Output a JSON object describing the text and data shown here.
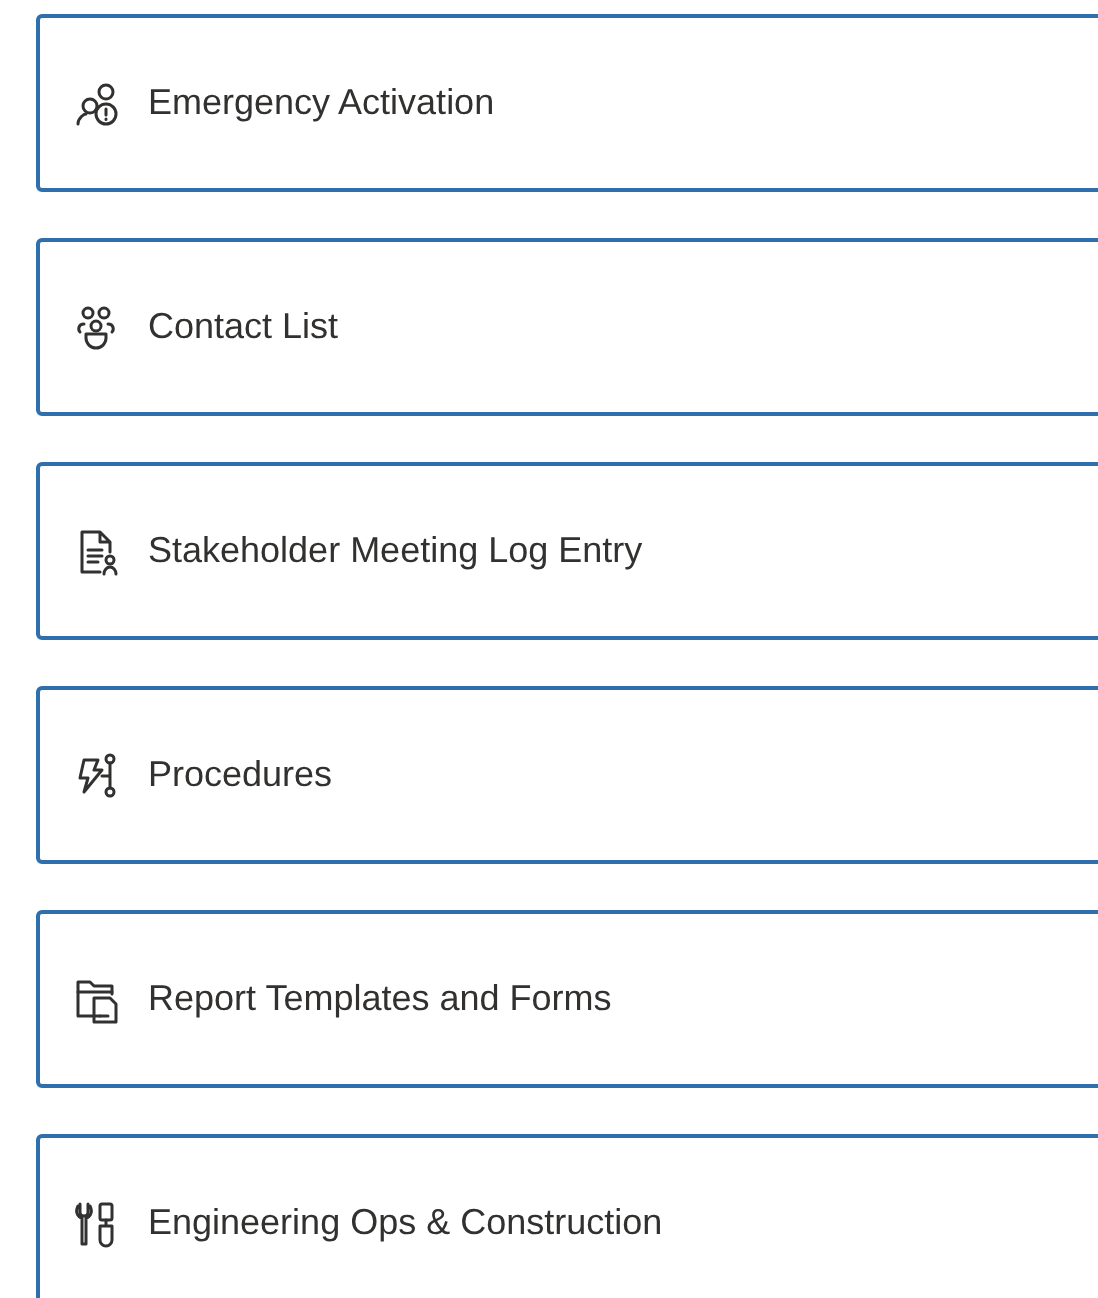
{
  "tiles": [
    {
      "kind": "emergency",
      "label": "Emergency Activation"
    },
    {
      "kind": "contacts",
      "label": "Contact List"
    },
    {
      "kind": "meeting-log",
      "label": "Stakeholder Meeting Log Entry"
    },
    {
      "kind": "procedures",
      "label": "Procedures"
    },
    {
      "kind": "templates",
      "label": "Report Templates and Forms"
    },
    {
      "kind": "engineering",
      "label": "Engineering Ops & Construction"
    }
  ]
}
